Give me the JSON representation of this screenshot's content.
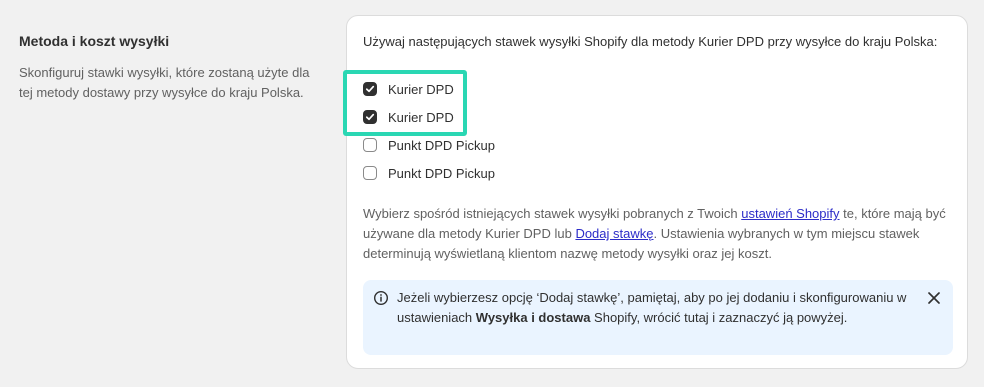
{
  "section": {
    "title": "Metoda i koszt wysyłki",
    "description": "Skonfiguruj stawki wysyłki, które zostaną użyte dla tej metody dostawy przy wysyłce do kraju Polska."
  },
  "card": {
    "intro": "Używaj następujących stawek wysyłki Shopify dla metody Kurier DPD przy wysyłce do kraju Polska:",
    "rates": [
      {
        "label": "Kurier DPD",
        "checked": true
      },
      {
        "label": "Kurier DPD",
        "checked": true
      },
      {
        "label": "Punkt DPD Pickup",
        "checked": false
      },
      {
        "label": "Punkt DPD Pickup",
        "checked": false
      }
    ],
    "help": {
      "part1": "Wybierz spośród istniejących stawek wysyłki pobranych z Twoich ",
      "link1": "ustawień Shopify",
      "part2": " te, które mają być używane dla metody Kurier DPD lub ",
      "link2": "Dodaj stawkę",
      "part3": ". Ustawienia wybranych w tym miejscu stawek determinują wyświetlaną klientom nazwę metody wysyłki oraz jej koszt."
    },
    "banner": {
      "part1": "Jeżeli wybierzesz opcję ‘Dodaj stawkę’, pamiętaj, aby po jej dodaniu i skonfigurowaniu w ustawieniach ",
      "bold": "Wysyłka i dostawa",
      "part2": " Shopify, wrócić tutaj i zaznaczyć ją powyżej.",
      "icon": "info-icon",
      "close_icon": "close-icon"
    }
  },
  "colors": {
    "highlight": "#2ad7b3",
    "link": "#2c2cc8",
    "banner_bg": "#eaf4ff",
    "checkbox_checked": "#303030"
  }
}
